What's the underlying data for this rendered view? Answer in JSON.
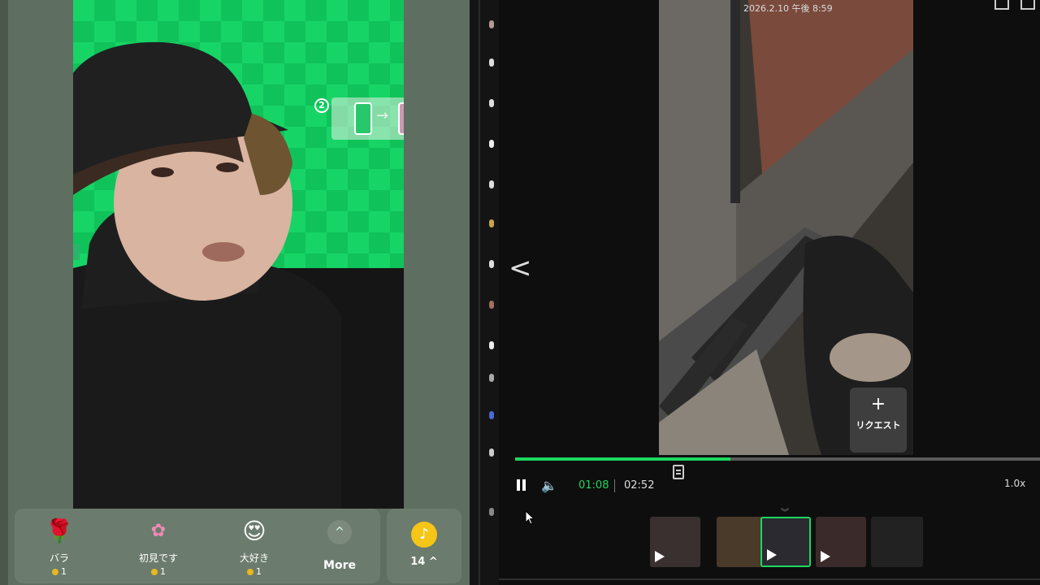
{
  "stream": {
    "overlay_step": "2",
    "gifts": [
      {
        "name": "バラ",
        "price": "1",
        "icon": "rose-icon"
      },
      {
        "name": "初見です",
        "price": "1",
        "icon": "hatsumi-sticker-icon"
      },
      {
        "name": "大好き",
        "price": "1",
        "icon": "heart-emoji-icon"
      }
    ],
    "more_label": "More",
    "coin_count": "14"
  },
  "player": {
    "video_timestamp": "2026.2.10 午後 8:59",
    "request_label": "リクエスト",
    "current_time": "01:08",
    "total_time": "02:52",
    "progress": 0.41,
    "speed": "1.0x",
    "thumbnails_count": 5,
    "active_thumbnail": 2
  },
  "colors": {
    "accent": "#1ed760",
    "green_screen": "#17d466",
    "coin": "#f5c518"
  }
}
